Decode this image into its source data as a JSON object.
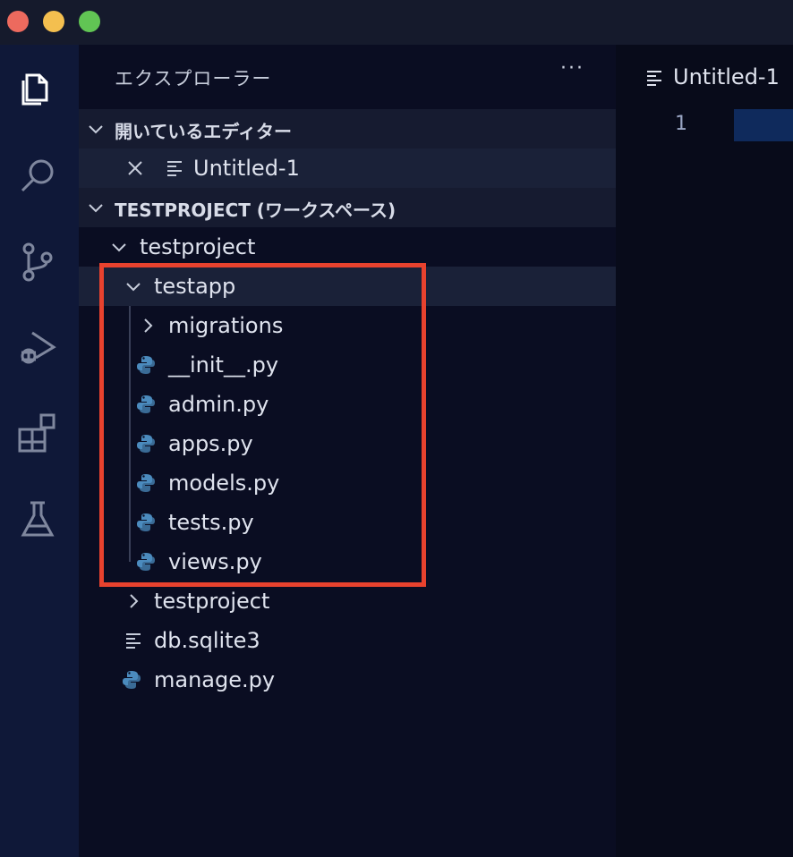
{
  "sidebar": {
    "title": "エクスプローラー",
    "more_label": "···",
    "open_editors": {
      "label": "開いているエディター",
      "items": [
        {
          "label": "Untitled-1"
        }
      ]
    },
    "workspace": {
      "label": "TESTPROJECT (ワークスペース)"
    },
    "tree": {
      "root": "testproject",
      "testapp": "testapp",
      "testapp_children": [
        "migrations",
        "__init__.py",
        "admin.py",
        "apps.py",
        "models.py",
        "tests.py",
        "views.py"
      ],
      "sub_testproject": "testproject",
      "db": "db.sqlite3",
      "manage": "manage.py"
    }
  },
  "editor": {
    "tab_label": "Untitled-1",
    "line_number": "1"
  },
  "colors": {
    "highlight": "#e8422e",
    "python_icon": "#4b8bbe"
  }
}
